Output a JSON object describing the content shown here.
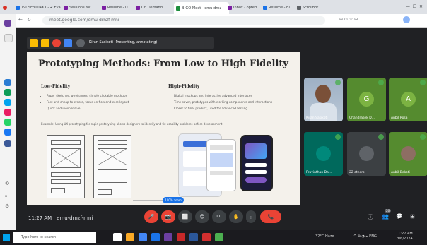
{
  "browser": {
    "tabs": [
      {
        "label": "19CSE3004XX - ✔ Evaluatio",
        "color": "#1a73e8"
      },
      {
        "label": "Sessions for...",
        "color": "#7b1fa2"
      },
      {
        "label": "Resume - U...",
        "color": "#7b1fa2"
      },
      {
        "label": "On Demand...",
        "color": "#7b1fa2"
      },
      {
        "label": "B-GO Meet - emu-drnz",
        "color": "#1e8e3e",
        "active": true
      },
      {
        "label": "Inbox - opted",
        "color": "#7b1fa2"
      },
      {
        "label": "Resume - Bl...",
        "color": "#1a73e8"
      },
      {
        "label": "ScrollBot",
        "color": "#5f6368"
      }
    ],
    "url": "meet.google.com/emu-drnzf-mni",
    "window_controls": [
      "—",
      "☐",
      "✕"
    ]
  },
  "presenter_bar": {
    "label": "Kiran Sasikoti (Presenting, annotating)"
  },
  "slide": {
    "title": "Prototyping Methods: From Low to High Fidelity",
    "low": {
      "heading": "Low-Fidelity",
      "bullets": [
        "Paper sketches, wireframes, simple clickable mockups",
        "Fast and cheap to create, focus on flow and core layout",
        "Quick and inexpensive"
      ]
    },
    "high": {
      "heading": "High-Fidelity",
      "bullets": [
        "Digital mockups and interactive advanced interfaces",
        "Time saver, prototypes with working components and interactions",
        "Closer to final product, used for advanced testing"
      ]
    },
    "example": "Example: Using UX prototyping for rapid prototyping allows designers to identify and fix usability problems before development",
    "slider_label": "100% zoom"
  },
  "tiles": [
    {
      "name": "Kiran Sasikoti",
      "color": "#3c4043",
      "type": "video"
    },
    {
      "name": "Chandrasek D...",
      "initial": "G",
      "color": "#558b2f",
      "avcolor": "#7cb342"
    },
    {
      "name": "Anbil Rosa",
      "initial": "A",
      "color": "#558b2f",
      "avcolor": "#7cb342"
    },
    {
      "name": "Pravinthan Da...",
      "initial": "",
      "color": "#00695c",
      "avcolor": "#00897b"
    },
    {
      "name": "22 others",
      "initial": "",
      "color": "#3c4043",
      "avcolor": "#5f6368"
    },
    {
      "name": "Anbil Bekoti",
      "initial": "",
      "color": "#558b2f",
      "avcolor": "#8d6e63"
    }
  ],
  "meeting": {
    "time": "11:27 AM",
    "code": "emu-drnzf-mni",
    "participant_count": "26"
  },
  "controls": [
    "🎤",
    "📷",
    "⬜",
    "😊",
    "CC",
    "✋",
    "⋮",
    "📞"
  ],
  "taskbar": {
    "search_placeholder": "Type here to search",
    "weather": "32°C Haze",
    "time": "11:27 AM",
    "date": "3/6/2024"
  }
}
